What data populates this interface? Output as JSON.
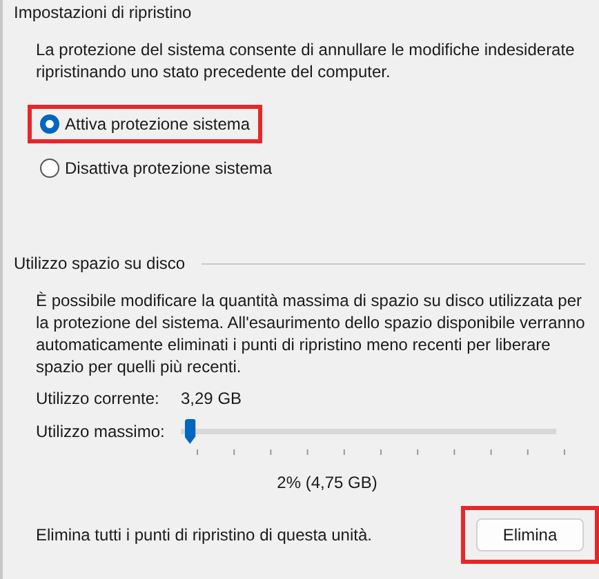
{
  "restore_settings": {
    "title": "Impostazioni di ripristino",
    "description": "La protezione del sistema consente di annullare le modifiche indesiderate ripristinando uno stato precedente del computer.",
    "options": [
      {
        "label": "Attiva protezione sistema",
        "selected": true,
        "highlighted": true
      },
      {
        "label": "Disattiva protezione sistema",
        "selected": false,
        "highlighted": false
      }
    ]
  },
  "disk_usage": {
    "title": "Utilizzo spazio su disco",
    "description": "È possibile modificare la quantità massima di spazio su disco utilizzata per la protezione del sistema. All'esaurimento dello spazio disponibile verranno automaticamente eliminati i punti di ripristino meno recenti per liberare spazio per quelli più recenti.",
    "current_label": "Utilizzo corrente:",
    "current_value": "3,29 GB",
    "max_label": "Utilizzo massimo:",
    "max_slider": {
      "level": 0.01
    },
    "max_reading": "2% (4,75 GB)",
    "delete_text": "Elimina tutti i punti di ripristino di questa unità.",
    "delete_button": {
      "label": "Elimina",
      "highlighted": true
    }
  }
}
